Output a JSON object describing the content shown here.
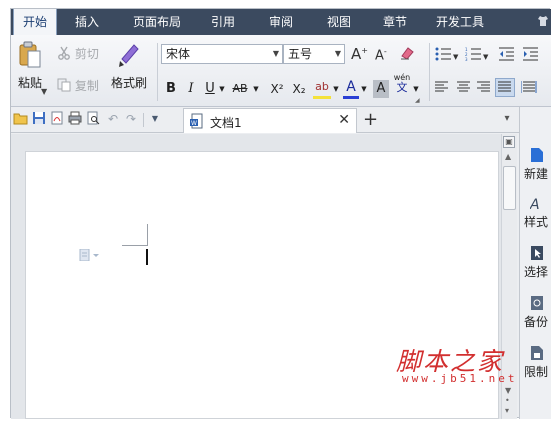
{
  "menubar": {
    "tabs": [
      "开始",
      "插入",
      "页面布局",
      "引用",
      "审阅",
      "视图",
      "章节",
      "开发工具"
    ],
    "active_tab": "开始"
  },
  "ribbon": {
    "paste_label": "粘贴",
    "cut_label": "剪切",
    "copy_label": "复制",
    "format_painter_label": "格式刷",
    "font_name": "宋体",
    "font_size": "五号",
    "grow_font": "A",
    "shrink_font": "A",
    "bold": "B",
    "italic": "I",
    "underline": "U",
    "strike": "AB",
    "superscript": "X²",
    "subscript": "X₂",
    "highlight": "ab",
    "font_color": "A",
    "char_shading": "A",
    "phonetic_top": "wén",
    "phonetic_bottom": "文"
  },
  "tabbar": {
    "doc_tab_label": "文档1"
  },
  "taskpane": {
    "items": [
      "新建",
      "样式",
      "选择",
      "备份",
      "限制"
    ]
  },
  "watermark": {
    "title": "脚本之家",
    "url": "www.jb51.net"
  },
  "colors": {
    "menubar_bg": "#3b4a5f",
    "accent": "#1d3f73",
    "watermark": "#d22f2f",
    "highlight_yellow": "#f4e23a",
    "font_color_blue": "#2a3fd4"
  }
}
